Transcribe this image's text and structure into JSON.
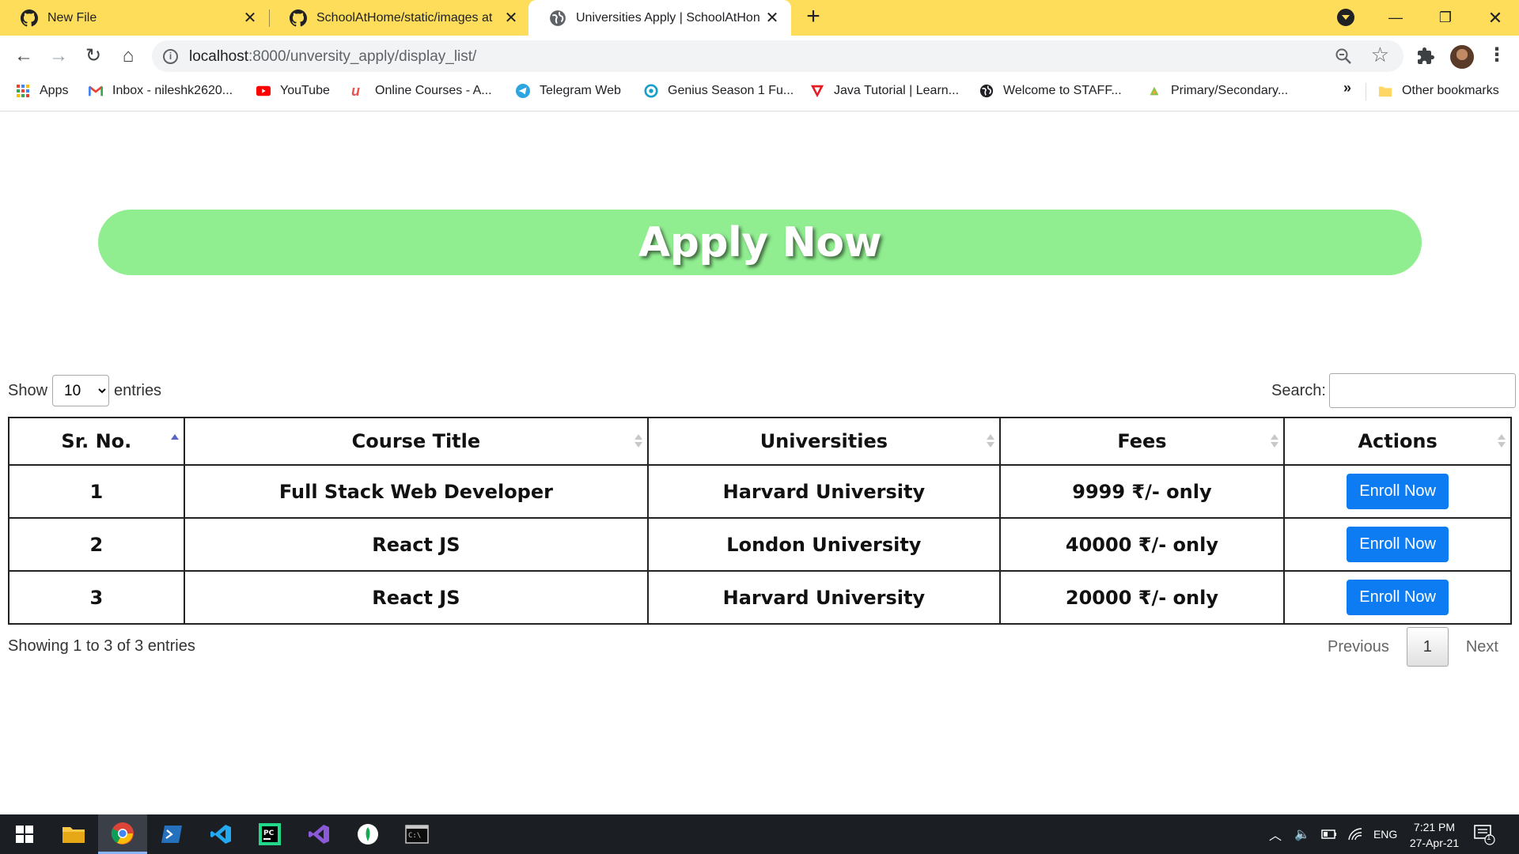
{
  "browser": {
    "tabs": [
      {
        "title": "New File",
        "favicon": "github-icon"
      },
      {
        "title": "SchoolAtHome/static/images at",
        "favicon": "github-icon"
      },
      {
        "title": "Universities Apply | SchoolAtHon",
        "favicon": "globe-icon",
        "active": true
      }
    ],
    "address": {
      "host": "localhost",
      "path": ":8000/unversity_apply/display_list/"
    },
    "bookmarks": [
      {
        "label": "Apps",
        "icon": "apps-grid-icon"
      },
      {
        "label": "Inbox - nileshk2620...",
        "icon": "gmail-icon"
      },
      {
        "label": "YouTube",
        "icon": "youtube-icon"
      },
      {
        "label": "Online Courses - A...",
        "icon": "udemy-icon"
      },
      {
        "label": "Telegram Web",
        "icon": "telegram-icon"
      },
      {
        "label": "Genius Season 1 Fu...",
        "icon": "genius-icon"
      },
      {
        "label": "Java Tutorial | Learn...",
        "icon": "javatpoint-icon"
      },
      {
        "label": "Welcome to STAFF...",
        "icon": "globe-icon"
      },
      {
        "label": "Primary/Secondary...",
        "icon": "leaf-icon"
      }
    ],
    "bookmarks_more": "»",
    "other_bookmarks": "Other bookmarks"
  },
  "page": {
    "banner": "Apply Now",
    "length": {
      "prefix": "Show",
      "value": "10",
      "suffix": "entries"
    },
    "search_label": "Search:",
    "table": {
      "headers": [
        "Sr. No.",
        "Course Title",
        "Universities",
        "Fees",
        "Actions"
      ],
      "rows": [
        {
          "sr": "1",
          "course": "Full Stack Web Developer",
          "university": "Harvard University",
          "fees": "9999 ₹/- only",
          "action": "Enroll Now"
        },
        {
          "sr": "2",
          "course": "React JS",
          "university": "London University",
          "fees": "40000 ₹/- only",
          "action": "Enroll Now"
        },
        {
          "sr": "3",
          "course": "React JS",
          "university": "Harvard University",
          "fees": "20000 ₹/- only",
          "action": "Enroll Now"
        }
      ]
    },
    "info": "Showing 1 to 3 of 3 entries",
    "pagination": {
      "previous": "Previous",
      "current": "1",
      "next": "Next"
    }
  },
  "taskbar": {
    "lang": "ENG",
    "time": "7:21 PM",
    "date": "27-Apr-21",
    "notifications": "1"
  },
  "colors": {
    "tab_strip": "#fedd5b",
    "banner": "#90ee90",
    "enroll_button": "#0d7cf2"
  }
}
